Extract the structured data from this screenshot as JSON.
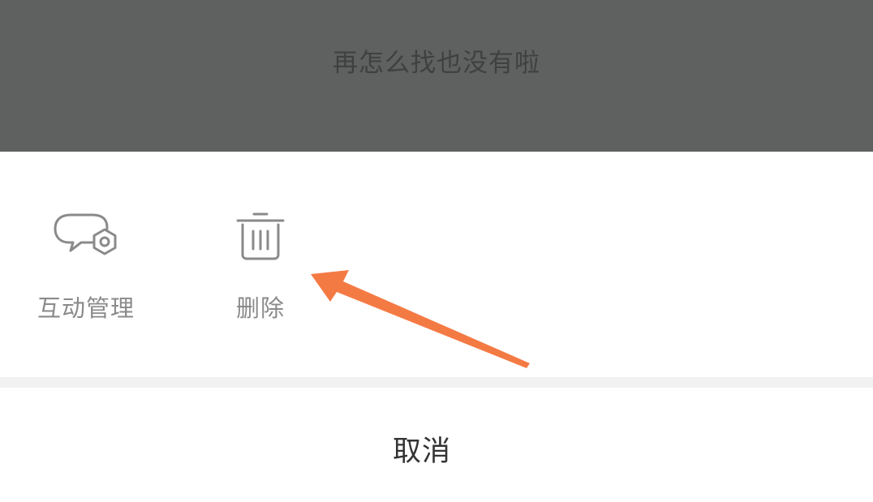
{
  "overlay": {
    "message": "再怎么找也没有啦"
  },
  "action_sheet": {
    "actions": [
      {
        "label": "互动管理",
        "icon": "chat-settings-icon"
      },
      {
        "label": "删除",
        "icon": "trash-icon"
      }
    ],
    "cancel_label": "取消"
  },
  "annotation": {
    "type": "arrow",
    "points_to": "删除",
    "color": "#f47a44"
  },
  "colors": {
    "overlay_bg": "#5f6060",
    "sheet_bg": "#ffffff",
    "divider": "#f2f2f2",
    "icon_stroke": "#8a8a8a",
    "label": "#8a8a8a",
    "cancel_text": "#333333"
  }
}
